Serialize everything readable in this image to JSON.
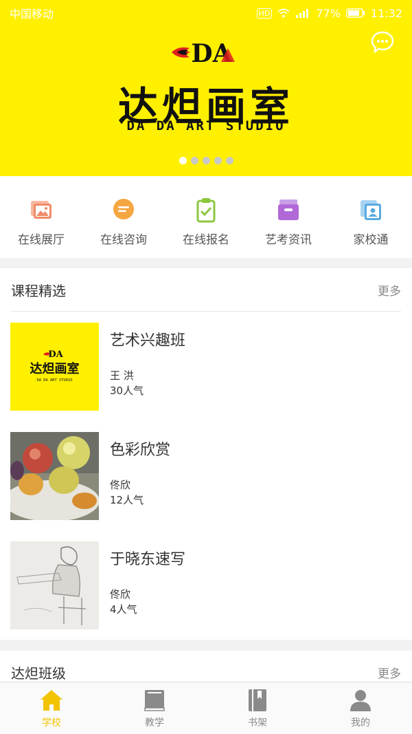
{
  "status_bar": {
    "carrier": "中国移动",
    "network": "HD",
    "battery": "77%",
    "time": "11:32"
  },
  "banner": {
    "logo_text": "达炟画室",
    "logo_subtitle": "DA DA  ART STUDIO",
    "logo_mark": "DA",
    "slide_count": 5,
    "active_slide": 0,
    "background_color": "#fff000"
  },
  "quick_nav": [
    {
      "label": "在线展厅",
      "icon": "gallery-icon",
      "color": "#f08c6a"
    },
    {
      "label": "在线咨询",
      "icon": "chat-bubble-icon",
      "color": "#f4a640"
    },
    {
      "label": "在线报名",
      "icon": "clipboard-check-icon",
      "color": "#8cc63f"
    },
    {
      "label": "艺考资讯",
      "icon": "inbox-icon",
      "color": "#b069d6"
    },
    {
      "label": "家校通",
      "icon": "contact-card-icon",
      "color": "#5aaae0"
    }
  ],
  "courses_section": {
    "title": "课程精选",
    "more": "更多",
    "items": [
      {
        "title": "艺术兴趣班",
        "teacher": "王 洪",
        "popularity": "30人气",
        "thumb": "logo-thumbnail",
        "thumb_text": "达炟画室",
        "thumb_sub": "DA DA ART STUDIO"
      },
      {
        "title": "色彩欣赏",
        "teacher": "佟欣",
        "popularity": "12人气",
        "thumb": "fruit-painting"
      },
      {
        "title": "于晓东速写",
        "teacher": "佟欣",
        "popularity": "4人气",
        "thumb": "sketch-drawing"
      }
    ]
  },
  "classes_section": {
    "title": "达炟班级",
    "more": "更多"
  },
  "tab_bar": [
    {
      "label": "学校",
      "icon": "home-icon",
      "active": true
    },
    {
      "label": "教学",
      "icon": "book-icon",
      "active": false
    },
    {
      "label": "书架",
      "icon": "bookshelf-icon",
      "active": false
    },
    {
      "label": "我的",
      "icon": "user-icon",
      "active": false
    }
  ],
  "colors": {
    "accent": "#f2c400",
    "banner": "#fff000",
    "inactive_tab": "#8a8a8a"
  }
}
